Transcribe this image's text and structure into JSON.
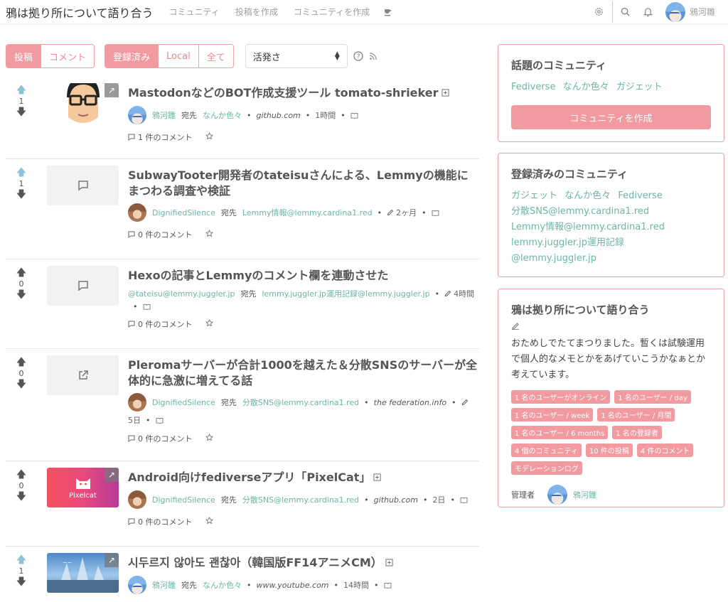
{
  "nav": {
    "brand": "鴉は拠り所について語り合う",
    "links": [
      "コミュニティ",
      "投稿を作成",
      "コミュニティを作成"
    ],
    "user": "鴉河雛"
  },
  "filters": {
    "type_buttons": [
      "投稿",
      "コメント"
    ],
    "type_active": 0,
    "listing_buttons": [
      "登録済み",
      "Local",
      "全て"
    ],
    "listing_active": 0,
    "sort_value": "活発さ"
  },
  "posts": [
    {
      "score": "1",
      "upvoted": true,
      "title": "MastodonなどのBOT作成支援ツール tomato-shrieker",
      "author": "鴉河雛",
      "to_label": "宛先",
      "community": "なんか色々",
      "domain": "github.com",
      "time": "1時間",
      "comments": "1 件のコメント",
      "thumb": "face",
      "avatar": "blue"
    },
    {
      "score": "1",
      "upvoted": true,
      "title": "SubwayTooter開発者のtateisuさんによる、Lemmyの機能にまつわる調査や検証",
      "author": "DignifiedSilence",
      "to_label": "宛先",
      "community": "Lemmy情報@lemmy.cardina1.red",
      "domain": "",
      "time": "2ヶ月",
      "comments": "0 件のコメント",
      "thumb": "text",
      "avatar": "brown"
    },
    {
      "score": "0",
      "upvoted": false,
      "title": "Hexoの記事とLemmyのコメント欄を連動させた",
      "author": "@tateisu@lemmy.juggler.jp",
      "to_label": "宛先",
      "community": "lemmy.juggler.jp運用記録@lemmy.juggler.jp",
      "domain": "",
      "time": "4時間",
      "comments": "0 件のコメント",
      "thumb": "text",
      "avatar": "none"
    },
    {
      "score": "0",
      "upvoted": false,
      "title": "Pleromaサーバーが合計1000を越えた＆分散SNSのサーバーが全体的に急激に増えてる話",
      "author": "DignifiedSilence",
      "to_label": "宛先",
      "community": "分散SNS@lemmy.cardina1.red",
      "domain": "the federation.info",
      "time": "5日",
      "comments": "0 件のコメント",
      "thumb": "link",
      "avatar": "brown"
    },
    {
      "score": "0",
      "upvoted": false,
      "title": "Android向けfediverseアプリ「PixelCat」",
      "author": "DignifiedSilence",
      "to_label": "宛先",
      "community": "分散SNS@lemmy.cardina1.red",
      "domain": "github.com",
      "time": "2日",
      "comments": "0 件のコメント",
      "thumb": "pixelcat",
      "thumb_label": "Pixelcat",
      "avatar": "brown"
    },
    {
      "score": "1",
      "upvoted": true,
      "title": "시두르지 않아도 괜찮아（韓国版FF14アニメCM）",
      "author": "鴉河雛",
      "to_label": "宛先",
      "community": "なんか色々",
      "domain": "www.youtube.com",
      "time": "14時間",
      "comments": "",
      "thumb": "ff",
      "avatar": "blue"
    }
  ],
  "sidebar": {
    "trending": {
      "title": "話題のコミュニティ",
      "links": [
        "Fediverse",
        "なんか色々",
        "ガジェット"
      ],
      "create_label": "コミュニティを作成"
    },
    "subscribed": {
      "title": "登録済みのコミュニティ",
      "links": [
        "ガジェット",
        "なんか色々",
        "Fediverse",
        "分散SNS@lemmy.cardina1.red",
        "Lemmy情報@lemmy.cardina1.red",
        "lemmy.juggler.jp運用記録",
        "@lemmy.juggler.jp"
      ]
    },
    "site": {
      "title": "鴉は拠り所について語り合う",
      "description": "おためしでたてまつりました。暫くは試験運用で個人的なメモとかをあげていこうかなぁとか考えています。",
      "badges": [
        "1 名のユーザーがオンライン",
        "1 名のユーザー / day",
        "1 名のユーザー / week",
        "1 名のユーザー / 月間",
        "1 名のユーザー / 6 months",
        "1 名の登録者",
        "4 個のコミュニティ",
        "10 件の投稿",
        "4 件のコメント",
        "モデレーションログ"
      ],
      "mods_label": "管理者",
      "mod_user": "鴉河雛"
    }
  },
  "colors": {
    "accent": "#f19aa0",
    "link": "#6bb6a6"
  }
}
